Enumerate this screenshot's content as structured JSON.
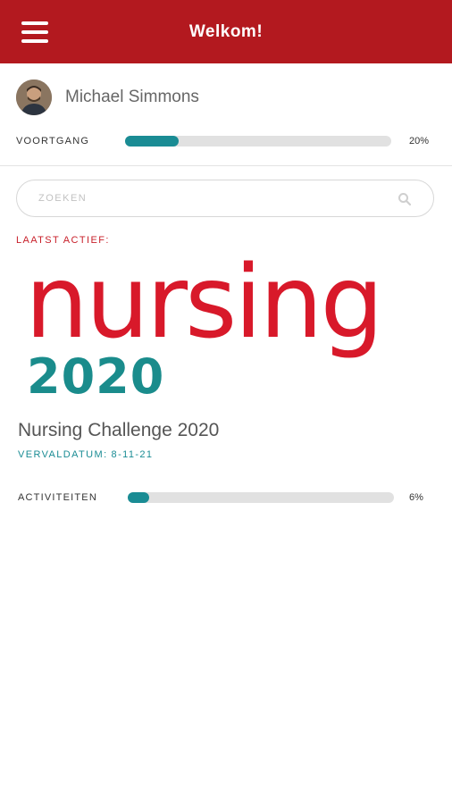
{
  "header": {
    "title": "Welkom!",
    "menu_icon": "hamburger-menu-icon",
    "bg_color": "#b3191f"
  },
  "user": {
    "name": "Michael Simmons"
  },
  "progress": {
    "label": "VOORTGANG",
    "percent": 20,
    "percent_text": "20%"
  },
  "search": {
    "placeholder": "ZOEKEN",
    "icon": "search-icon"
  },
  "recent": {
    "section_label": "LAATST ACTIEF:",
    "banner": {
      "word": "nursing",
      "year": "2020",
      "word_color": "#d8192a",
      "year_color": "#1a8c8c"
    },
    "course_title": "Nursing Challenge 2020",
    "due_label": "VERVALDATUM:",
    "due_date": "8-11-21",
    "activities": {
      "label": "ACTIVITEITEN",
      "percent": 6,
      "percent_text": "6%"
    }
  },
  "colors": {
    "accent": "#1a8c94",
    "brand": "#b3191f"
  }
}
